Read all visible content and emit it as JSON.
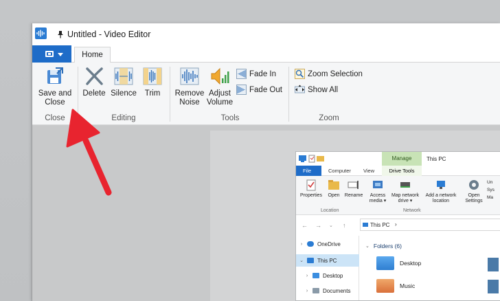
{
  "window": {
    "title": "Untitled - Video Editor"
  },
  "ribbon": {
    "tabs": [
      {
        "label": "Home"
      }
    ],
    "groups": {
      "close": {
        "label": "Close",
        "save_close_line1": "Save and",
        "save_close_line2": "Close"
      },
      "editing": {
        "label": "Editing",
        "delete": "Delete",
        "silence": "Silence",
        "trim": "Trim"
      },
      "tools": {
        "label": "Tools",
        "remove_noise_line1": "Remove",
        "remove_noise_line2": "Noise",
        "adjust_volume_line1": "Adjust",
        "adjust_volume_line2": "Volume",
        "fade_in": "Fade In",
        "fade_out": "Fade Out"
      },
      "zoom": {
        "label": "Zoom",
        "zoom_selection": "Zoom Selection",
        "show_all": "Show All"
      }
    }
  },
  "explorer": {
    "title_tab_manage": "Manage",
    "title_text": "This PC",
    "tabs": {
      "file": "File",
      "computer": "Computer",
      "view": "View",
      "drive_tools": "Drive Tools"
    },
    "ribbon_buttons": {
      "properties": "Properties",
      "open": "Open",
      "rename": "Rename",
      "access_media_line1": "Access",
      "access_media_line2": "media ▾",
      "map_network_line1": "Map network",
      "map_network_line2": "drive ▾",
      "add_network_line1": "Add a network",
      "add_network_line2": "location",
      "open_settings_line1": "Open",
      "open_settings_line2": "Settings",
      "right_item_1": "Un",
      "right_item_2": "Sys",
      "right_item_3": "Ma"
    },
    "group_labels": {
      "location": "Location",
      "network": "Network"
    },
    "address_path": "This PC",
    "address_separator": "›",
    "sidebar": [
      {
        "label": "OneDrive"
      },
      {
        "label": "This PC"
      },
      {
        "label": "Desktop"
      },
      {
        "label": "Documents"
      }
    ],
    "main": {
      "section_label": "Folders (6)",
      "folders": [
        {
          "label": "Desktop"
        },
        {
          "label": "Music"
        }
      ]
    },
    "colors": {
      "accent_blue": "#1e6cc8",
      "manage_green": "#c8e3b6"
    }
  },
  "annotation": {
    "arrow_color": "#e8242f"
  }
}
